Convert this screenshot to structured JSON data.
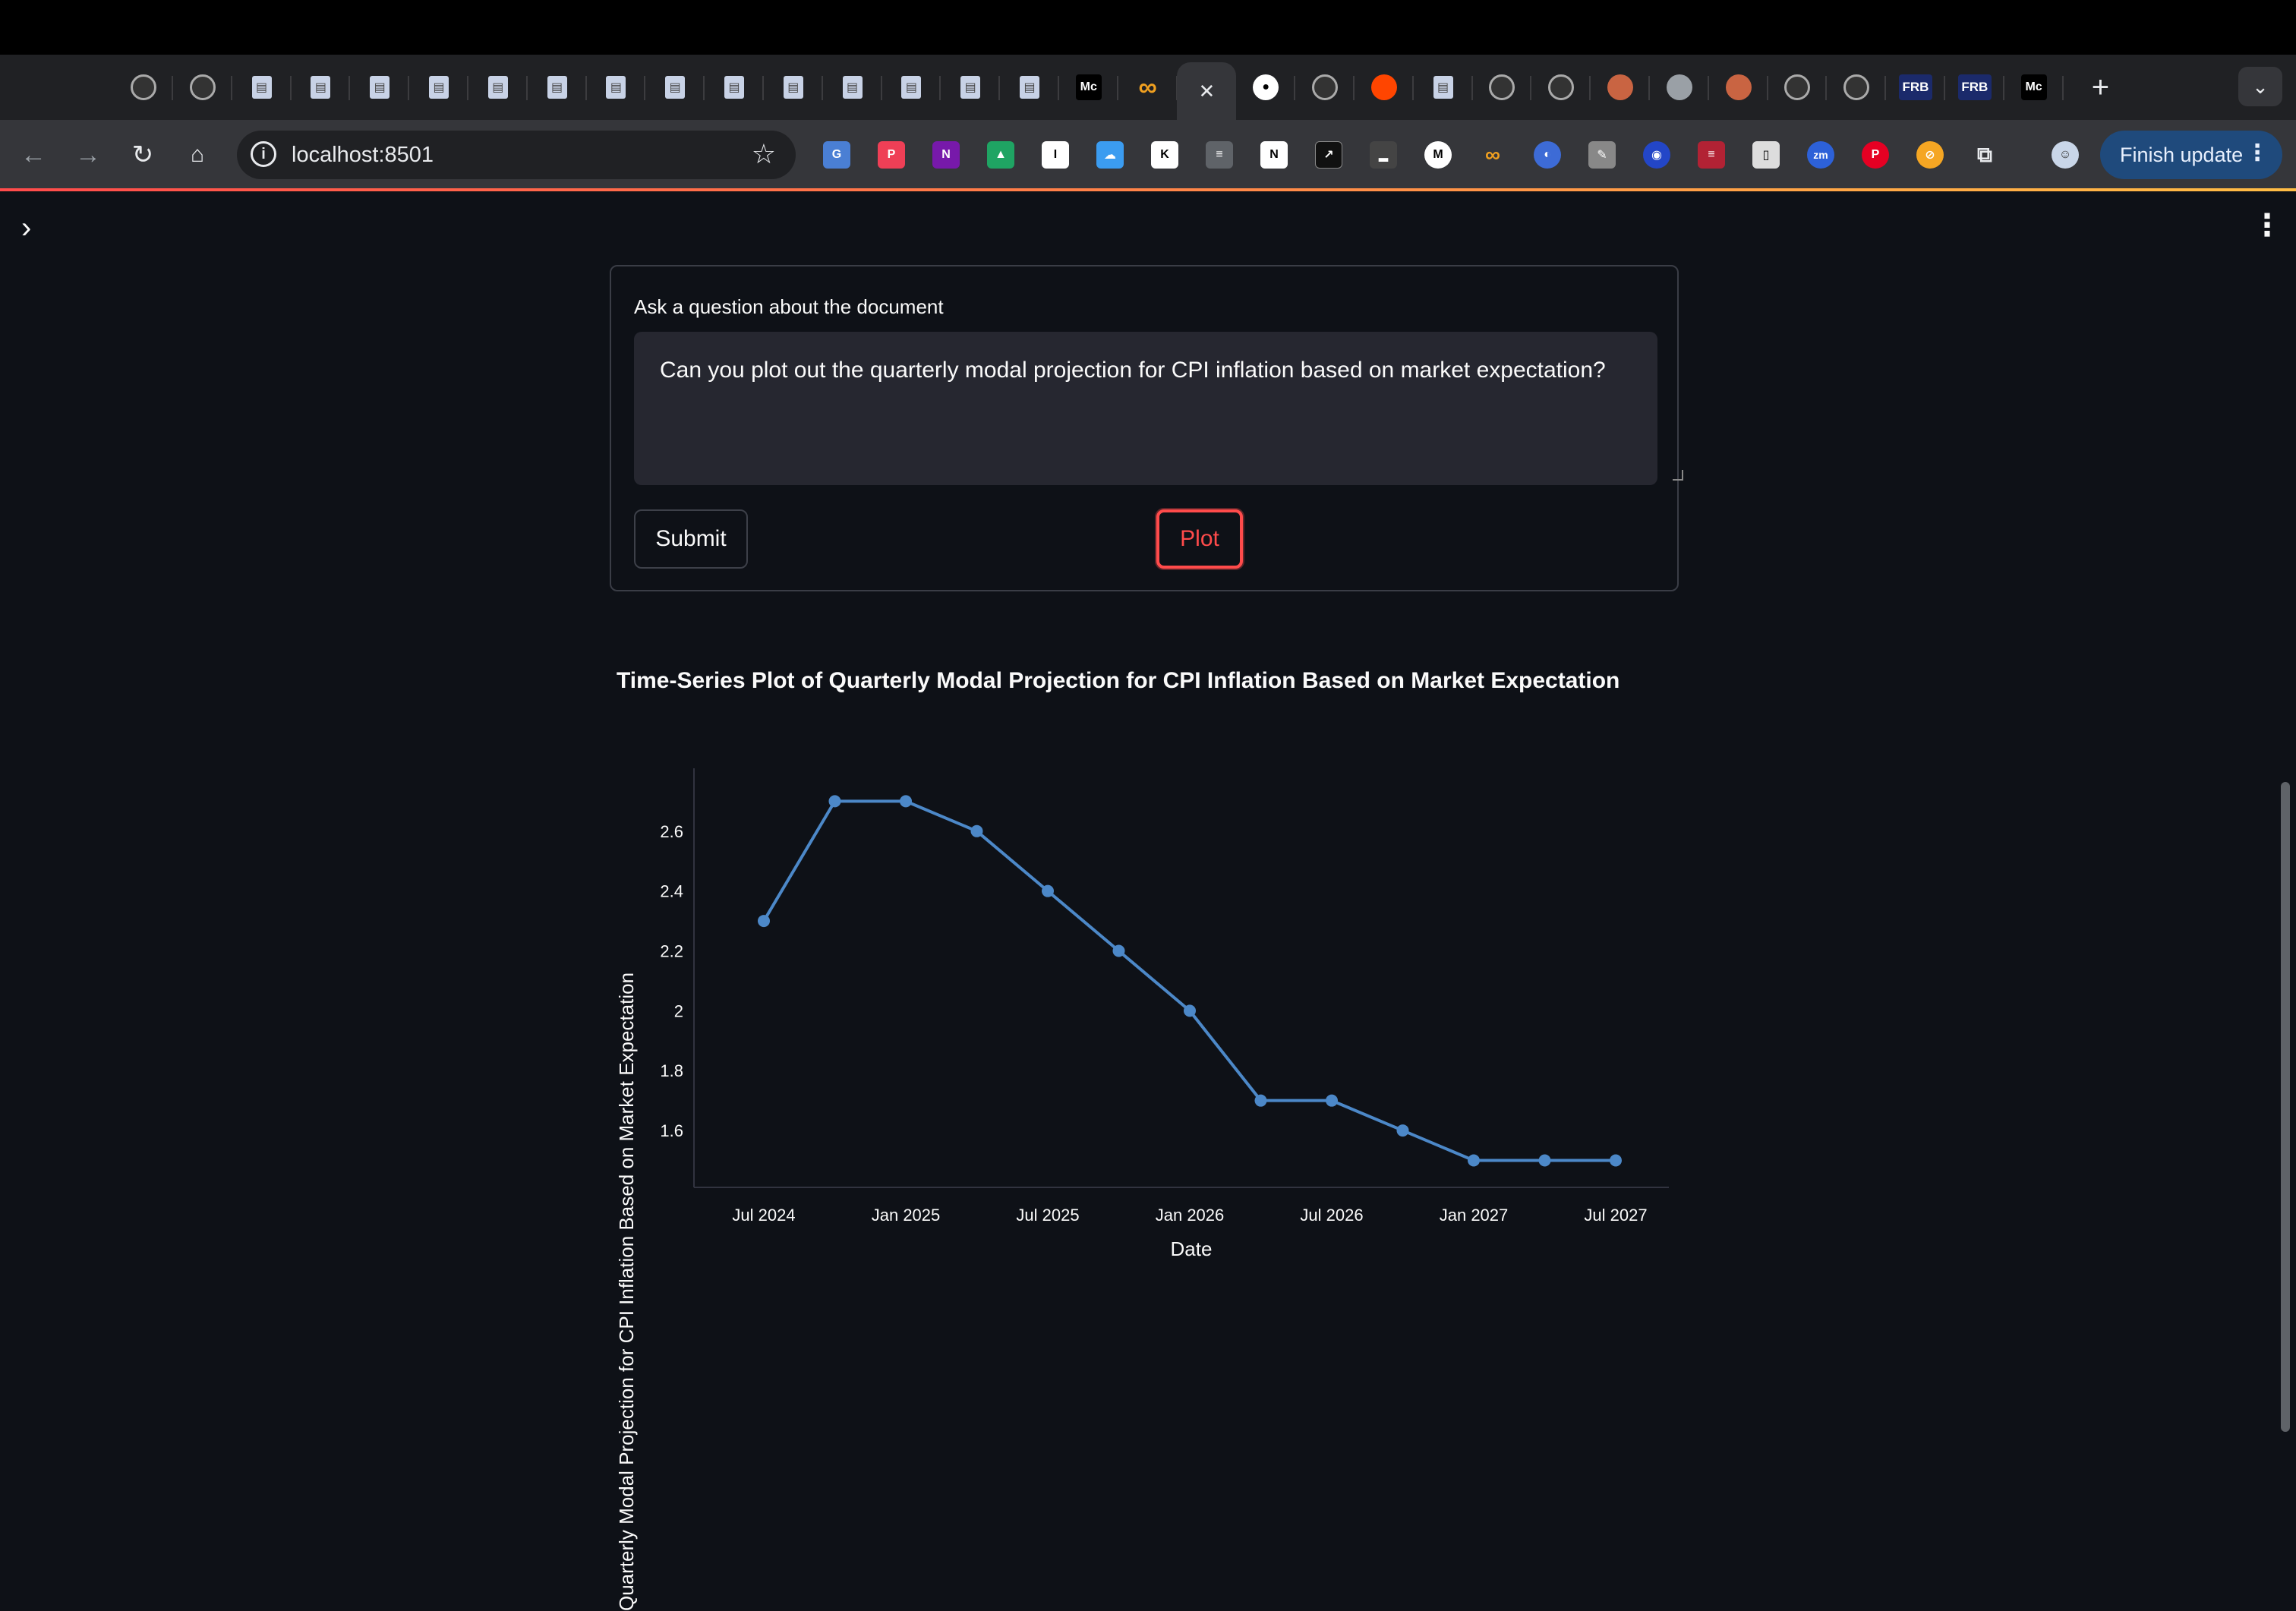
{
  "browser": {
    "url": "localhost:8501",
    "finish_update_label": "Finish update",
    "tab_favicons": [
      "chatgpt-icon",
      "perplexity-icon",
      "doc-icon",
      "doc-icon",
      "doc-icon",
      "doc-icon",
      "doc-icon",
      "doc-icon",
      "doc-icon",
      "doc-icon",
      "doc-icon",
      "doc-icon",
      "doc-icon",
      "doc-icon",
      "doc-icon",
      "doc-icon",
      "medium-icon",
      "infinity-icon",
      "close-icon",
      "github-icon",
      "chatgpt-icon",
      "reddit-icon",
      "doc-icon",
      "chatgpt-icon",
      "perplexity-icon",
      "claude-icon",
      "globe-icon",
      "claude-icon",
      "chatgpt-icon",
      "chatgpt-icon",
      "frb-icon",
      "frb-icon",
      "medium-icon"
    ],
    "tab_texts": {
      "medium": "Mc",
      "frb": "FRB"
    }
  },
  "form": {
    "label": "Ask a question about the document",
    "question_value": "Can you plot out the quarterly modal projection for CPI inflation based on market expectation?",
    "submit_label": "Submit",
    "plot_label": "Plot"
  },
  "chart_data": {
    "type": "line",
    "title": "Time-Series Plot of Quarterly Modal Projection for CPI Inflation Based on Market Expectation",
    "xlabel": "Date",
    "ylabel": "Quarterly Modal Projection for CPI Inflation Based on Market Expectation",
    "x": [
      "2024-07",
      "2024-10",
      "2025-01",
      "2025-04",
      "2025-07",
      "2025-10",
      "2026-01",
      "2026-04",
      "2026-07",
      "2026-10",
      "2027-01",
      "2027-04",
      "2027-07"
    ],
    "values": [
      2.3,
      2.7,
      2.7,
      2.6,
      2.4,
      2.2,
      2.0,
      1.7,
      1.7,
      1.6,
      1.5,
      1.5,
      1.5
    ],
    "x_ticks": [
      "Jul 2024",
      "Jan 2025",
      "Jul 2025",
      "Jan 2026",
      "Jul 2026",
      "Jan 2027",
      "Jul 2027"
    ],
    "y_ticks": [
      1.6,
      1.8,
      2,
      2.2,
      2.4,
      2.6
    ],
    "ylim": [
      1.41,
      2.81
    ],
    "grid": false,
    "line_color": "#4c88c8"
  }
}
